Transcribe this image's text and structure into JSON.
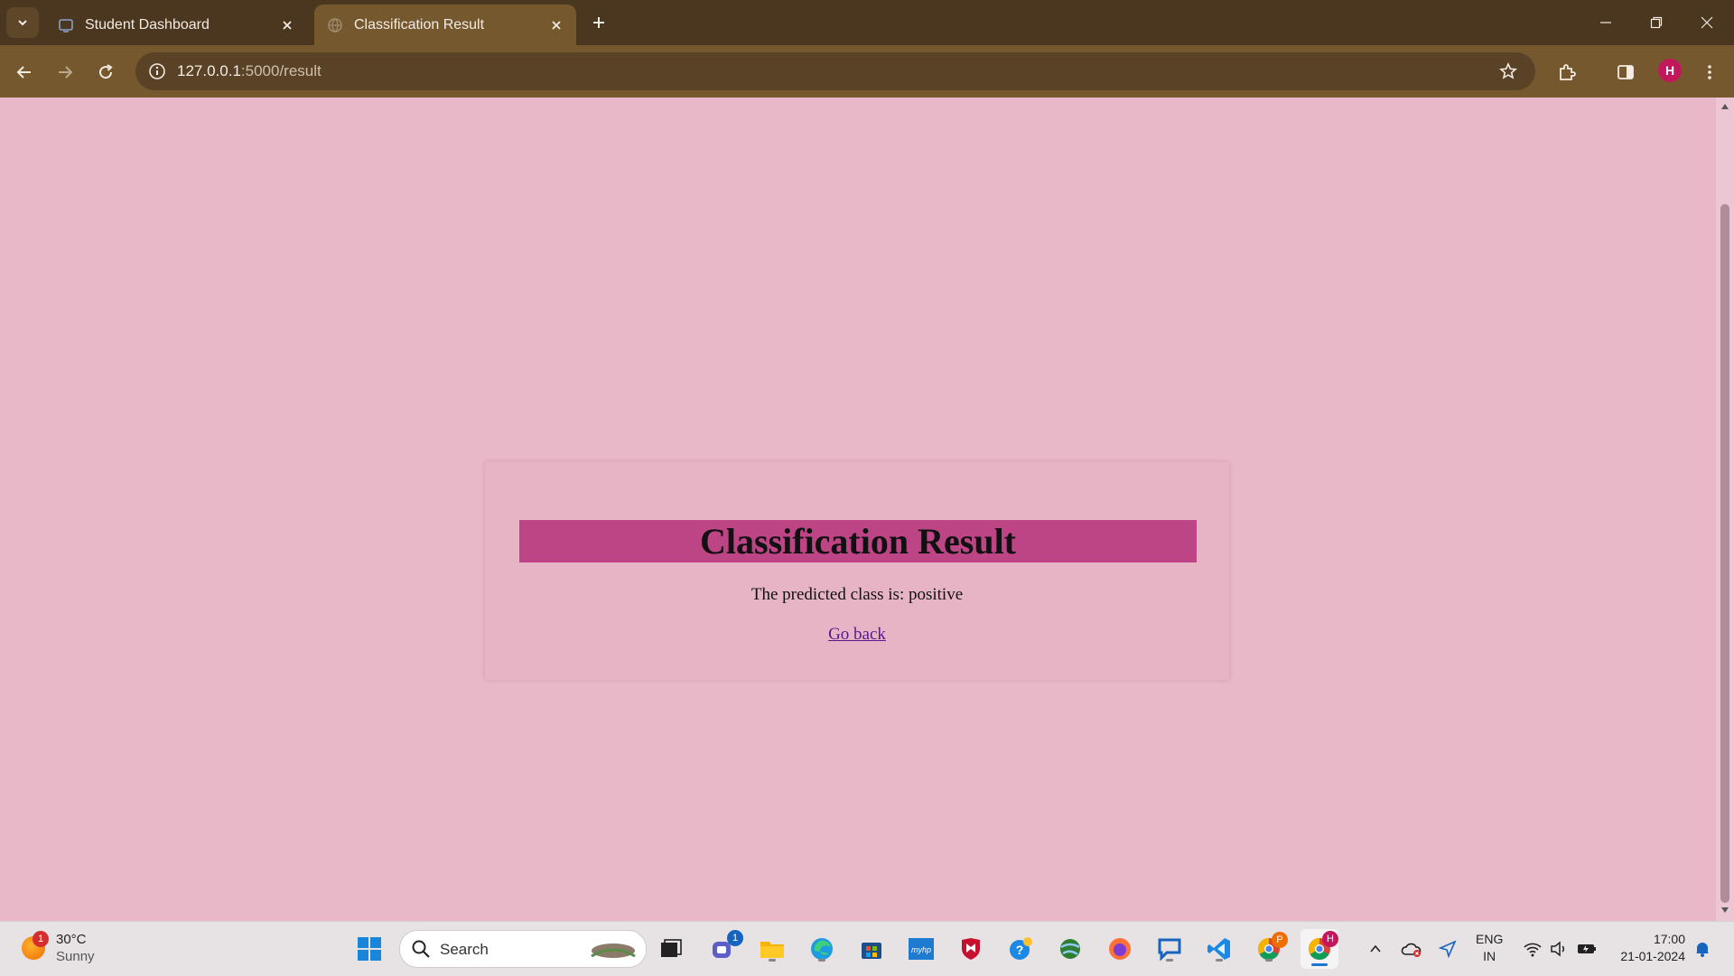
{
  "browser": {
    "tabs": [
      {
        "title": "Student Dashboard",
        "active": false
      },
      {
        "title": "Classification Result",
        "active": true
      }
    ],
    "url_host": "127.0.0.1",
    "url_path": ":5000/result",
    "profile_initial": "H"
  },
  "page": {
    "heading": "Classification Result",
    "prediction_text": "The predicted class is: positive",
    "back_link": "Go back"
  },
  "taskbar": {
    "weather_temp": "30°C",
    "weather_condition": "Sunny",
    "weather_badge": "1",
    "search_placeholder": "Search",
    "teams_badge": "1",
    "chrome_profile_badge": "P",
    "chrome_active_badge": "H",
    "language_line1": "ENG",
    "language_line2": "IN",
    "time": "17:00",
    "date": "21-01-2024"
  },
  "colors": {
    "page_background": "#e8b7c8",
    "heading_background": "#bd4585",
    "link": "#551a8b",
    "browser_frame": "#4b361f"
  }
}
